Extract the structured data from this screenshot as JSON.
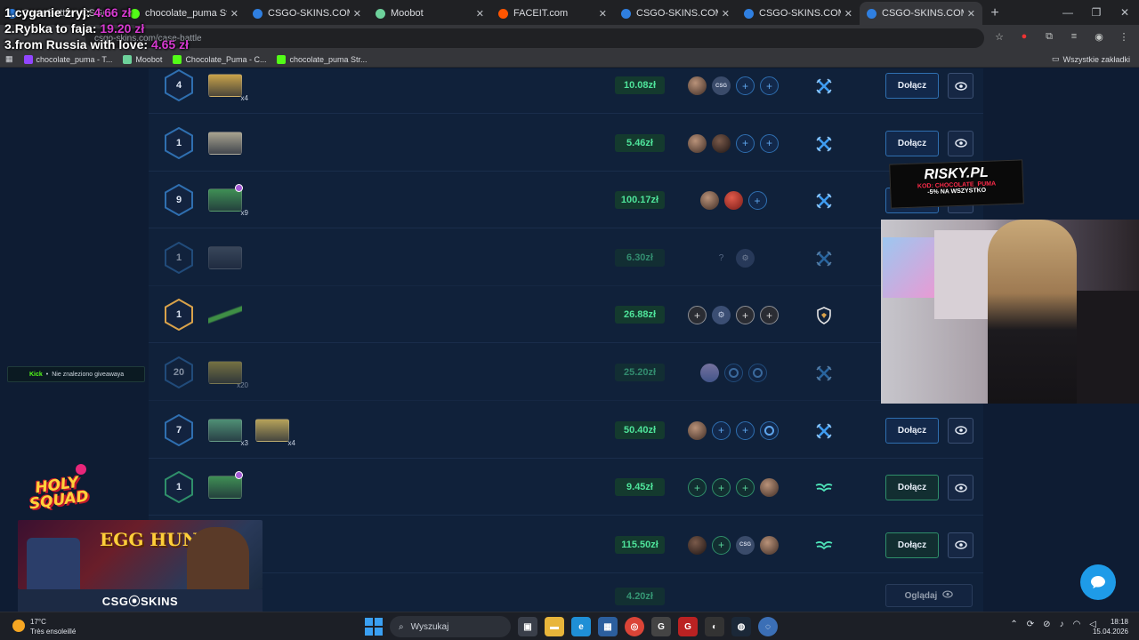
{
  "browser": {
    "tabs": [
      {
        "label": "Case Battle - CSGO-SKINS",
        "favicon_color": "#2f7fe0",
        "active": false
      },
      {
        "label": "chocolate_puma Stream",
        "favicon_color": "#53fc18",
        "active": false
      },
      {
        "label": "CSGO-SKINS.COM - Najle",
        "favicon_color": "#2f7fe0",
        "active": false
      },
      {
        "label": "Moobot",
        "favicon_color": "#6dd19b",
        "active": false
      },
      {
        "label": "FACEIT.com",
        "favicon_color": "#ff5500",
        "active": false
      },
      {
        "label": "CSGO-SKINS.COM - Najle",
        "favicon_color": "#2f7fe0",
        "active": false
      },
      {
        "label": "CSGO-SKINS.COM - Najle",
        "favicon_color": "#2f7fe0",
        "active": false
      },
      {
        "label": "CSGO-SKINS.COM - Najle",
        "favicon_color": "#2f7fe0",
        "active": true
      }
    ],
    "address": "csgo-skins.com/case-battle",
    "bookmarks": [
      {
        "label": "chocolate_puma - T...",
        "color": "#9146ff"
      },
      {
        "label": "Moobot",
        "color": "#6dd19b"
      },
      {
        "label": "Chocolate_Puma - C...",
        "color": "#53fc18"
      },
      {
        "label": "chocolate_puma Str...",
        "color": "#53fc18"
      }
    ],
    "bookmarks_folder": "Wszystkie zakładki"
  },
  "donations": [
    {
      "rank": "1.",
      "name": "cyganie żryj:",
      "amount": "4.66 zł"
    },
    {
      "rank": "2.",
      "name": "Rybka to faja:",
      "amount": "19.20 zł"
    },
    {
      "rank": "3.",
      "name": "from Russia with love:",
      "amount": "4.65 zł"
    }
  ],
  "battles": [
    {
      "rounds": "4",
      "ring": "#2f6fb0",
      "price": "10.08zł",
      "cases": [
        {
          "color": "#c9a34a",
          "mult": "x4"
        }
      ],
      "slots": [
        "avatar",
        "av-csg",
        "plus-b",
        "plus-b"
      ],
      "mode": "swords",
      "action": "Dołącz",
      "dim": false
    },
    {
      "rounds": "1",
      "ring": "#2f6fb0",
      "price": "5.46zł",
      "cases": [
        {
          "color": "#a8a38f",
          "mult": ""
        }
      ],
      "slots": [
        "avatar",
        "av-dark",
        "plus-b",
        "plus-b"
      ],
      "mode": "swords",
      "action": "Dołącz",
      "dim": false
    },
    {
      "rounds": "9",
      "ring": "#2f6fb0",
      "price": "100.17zł",
      "cases": [
        {
          "color": "#3f8f55",
          "mult": "x9",
          "badge": true
        }
      ],
      "slots": [
        "avatar",
        "av-red",
        "plus-b"
      ],
      "mode": "swords",
      "action": "Dołącz",
      "dim": false
    },
    {
      "rounds": "1",
      "ring": "#2f6fb0",
      "price": "6.30zł",
      "cases": [
        {
          "color": "#5a6575",
          "mult": ""
        }
      ],
      "slots": [
        "q",
        "av-bot"
      ],
      "mode": "swords",
      "action": "",
      "dim": true
    },
    {
      "rounds": "1",
      "ring": "#d9a24a",
      "price": "26.88zł",
      "cases": [
        {
          "color": "#3f8f45",
          "mult": "",
          "knife": true
        }
      ],
      "slots": [
        "plus-w",
        "av-bot",
        "plus-w",
        "plus-w"
      ],
      "mode": "shield",
      "action": "",
      "dim": false
    },
    {
      "rounds": "20",
      "ring": "#2f6fb0",
      "price": "25.20zł",
      "cases": [
        {
          "color": "#c9b34a",
          "mult": "x20"
        }
      ],
      "slots": [
        "av-globe",
        "target",
        "target"
      ],
      "mode": "swords",
      "action": "",
      "dim": true
    },
    {
      "rounds": "7",
      "ring": "#2f6fb0",
      "price": "50.40zł",
      "cases": [
        {
          "color": "#4f8f75",
          "mult": "x3"
        },
        {
          "color": "#b6a25a",
          "mult": "x4"
        }
      ],
      "slots": [
        "avatar",
        "plus-b",
        "plus-b",
        "target"
      ],
      "mode": "swords",
      "action": "Dołącz",
      "dim": false
    },
    {
      "rounds": "1",
      "ring": "#2f8f6a",
      "price": "9.45zł",
      "cases": [
        {
          "color": "#3f8f55",
          "mult": "",
          "badge": true
        }
      ],
      "slots": [
        "plus-g",
        "plus-g",
        "plus-g",
        "avatar"
      ],
      "mode": "wings",
      "action": "Dołącz",
      "green": true,
      "dim": false
    },
    {
      "rounds": "",
      "ring": "none",
      "price": "115.50zł",
      "cases": [],
      "slots": [
        "av-dark",
        "plus-g",
        "av-csg",
        "avatar"
      ],
      "mode": "wings",
      "action": "Dołącz",
      "green": true,
      "dim": false
    }
  ],
  "last_row": {
    "price": "4.20zł",
    "watch_label": "Oglądaj"
  },
  "overlays": {
    "kick_bar": {
      "brand": "Kick",
      "text": "Nie znaleziono giveawaya"
    },
    "holy_squad": "HOLY SQUAD",
    "egg_hunt_title": "EGG HUNT",
    "egg_hunt_brand": "CSG⦿SKINS",
    "risky": {
      "title": "RISKY.PL",
      "code": "KOD: CHOCOLATE_PUMA",
      "discount": "-5% NA WSZYSTKO"
    }
  },
  "taskbar": {
    "weather_temp": "17°C",
    "weather_desc": "Très ensoleillé",
    "search_placeholder": "Wyszukaj",
    "time": "18:18",
    "date": "15.04.2026"
  }
}
